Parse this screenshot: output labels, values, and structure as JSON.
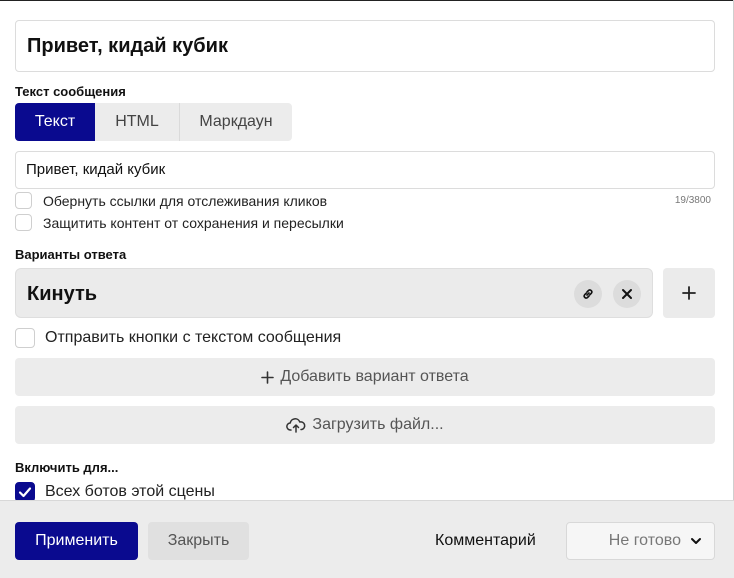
{
  "title": "Привет, кидай кубик",
  "message_section": {
    "label": "Текст сообщения",
    "tabs": [
      {
        "label": "Текст",
        "active": true
      },
      {
        "label": "HTML",
        "active": false
      },
      {
        "label": "Маркдаун",
        "active": false
      }
    ],
    "value": "Привет, кидай кубик",
    "counter": "19/3800",
    "options": [
      {
        "label": "Обернуть ссылки для отслеживания кликов",
        "checked": false
      },
      {
        "label": "Защитить контент от сохранения и пересылки",
        "checked": false
      }
    ]
  },
  "answers_section": {
    "label": "Варианты ответа",
    "answers": [
      {
        "label": "Кинуть",
        "icons": [
          "link-icon",
          "close-icon"
        ]
      }
    ],
    "add_icon": "plus-icon",
    "send_with_text": {
      "label": "Отправить кнопки с текстом сообщения",
      "checked": false
    },
    "add_answer_label": "Добавить вариант ответа",
    "upload_label": "Загрузить файл..."
  },
  "enable_section": {
    "label": "Включить для...",
    "options": [
      {
        "label": "Всех ботов этой сцены",
        "checked": true
      }
    ]
  },
  "footer": {
    "apply_label": "Применить",
    "close_label": "Закрыть",
    "comment_label": "Комментарий",
    "status_value": "Не готово"
  },
  "colors": {
    "accent": "#0a0a8f",
    "button_bg": "#ececec",
    "footer_bg": "#ececec"
  }
}
